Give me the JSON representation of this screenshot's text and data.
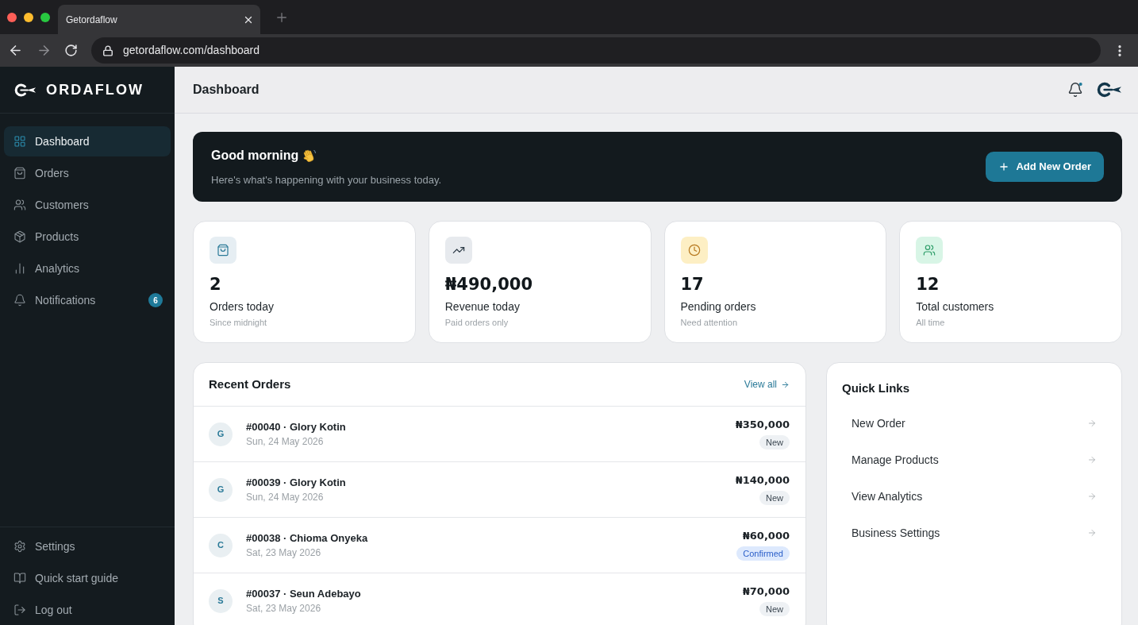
{
  "browser": {
    "tab_title": "Getordaflow",
    "url": "getordaflow.com/dashboard"
  },
  "sidebar": {
    "brand": "ORDAFLOW",
    "items": [
      {
        "label": "Dashboard",
        "selected": true
      },
      {
        "label": "Orders",
        "selected": false
      },
      {
        "label": "Customers",
        "selected": false
      },
      {
        "label": "Products",
        "selected": false
      },
      {
        "label": "Analytics",
        "selected": false
      },
      {
        "label": "Notifications",
        "selected": false,
        "badge": "6"
      }
    ],
    "footer_items": [
      {
        "label": "Settings",
        "selected": false
      },
      {
        "label": "Quick start guide",
        "selected": false
      },
      {
        "label": "Log out",
        "selected": false
      }
    ]
  },
  "header": {
    "title": "Dashboard"
  },
  "banner": {
    "greeting": "Good morning",
    "subtitle": "Here's what's happening with your business today.",
    "button": "Add New Order"
  },
  "stats": [
    {
      "color": "#e6eef3",
      "value": "2",
      "label": "Orders today",
      "note": "Since midnight"
    },
    {
      "color": "#e7eaee",
      "value": "₦490,000",
      "label": "Revenue today",
      "note": "Paid orders only"
    },
    {
      "color": "#fdefc4",
      "value": "17",
      "label": "Pending orders",
      "note": "Need attention"
    },
    {
      "color": "#d8f5e6",
      "value": "12",
      "label": "Total customers",
      "note": "All time"
    }
  ],
  "recent_orders": {
    "title": "Recent Orders",
    "link": "View all",
    "rows": [
      {
        "initial": "G",
        "title": "#00040 · Glory Kotin",
        "date": "Sun, 24 May 2026",
        "amount": "₦350,000",
        "status": {
          "label": "New",
          "kind": "new"
        }
      },
      {
        "initial": "G",
        "title": "#00039 · Glory Kotin",
        "date": "Sun, 24 May 2026",
        "amount": "₦140,000",
        "status": {
          "label": "New",
          "kind": "new"
        }
      },
      {
        "initial": "C",
        "title": "#00038 · Chioma Onyeka",
        "date": "Sat, 23 May 2026",
        "amount": "₦60,000",
        "status": {
          "label": "Confirmed",
          "kind": "confirmed"
        }
      },
      {
        "initial": "S",
        "title": "#00037 · Seun Adebayo",
        "date": "Sat, 23 May 2026",
        "amount": "₦70,000",
        "status": {
          "label": "New",
          "kind": "new"
        }
      }
    ]
  },
  "quick_links": {
    "title": "Quick Links",
    "items": [
      "New Order",
      "Manage Products",
      "View Analytics",
      "Business Settings"
    ]
  }
}
